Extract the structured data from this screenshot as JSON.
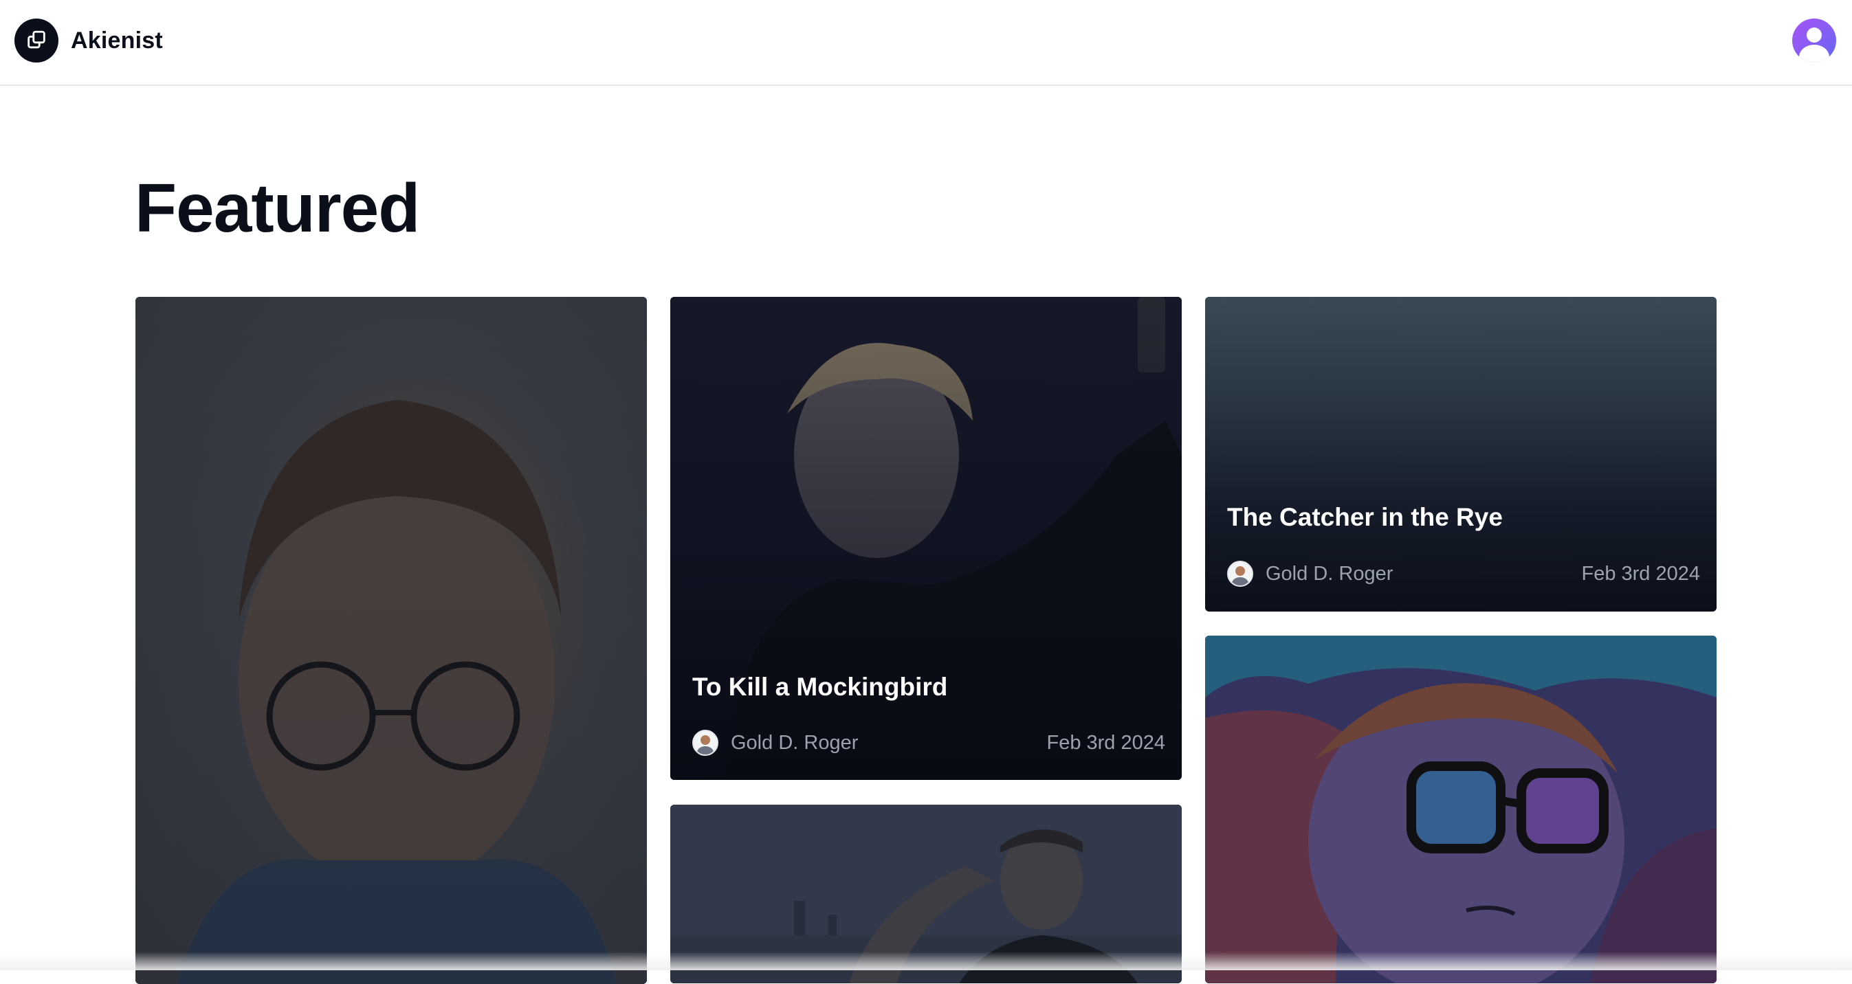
{
  "header": {
    "brand": "Akienist",
    "logo_icon": "layers-icon",
    "avatar_icon": "user-avatar-icon"
  },
  "main": {
    "title": "Featured"
  },
  "cards": [
    {
      "title": "",
      "author": "",
      "date": "",
      "image": "portrait-glasses-illustration"
    },
    {
      "title": "To Kill a Mockingbird",
      "author": "Gold D. Roger",
      "date": "Feb 3rd 2024",
      "image": "man-taking-selfie-photo"
    },
    {
      "title": "The Catcher in the Rye",
      "author": "Gold D. Roger",
      "date": "Feb 3rd 2024",
      "image": "dark-gradient"
    },
    {
      "title": "",
      "author": "",
      "date": "",
      "image": "man-saluting-city-photo"
    },
    {
      "title": "",
      "author": "",
      "date": "",
      "image": "cartoon-glasses-character"
    }
  ],
  "colors": {
    "primary": "#0b0f1a",
    "avatar_gradient_start": "#a855f7",
    "avatar_gradient_end": "#6366f1",
    "meta_text": "#9ca3af"
  }
}
